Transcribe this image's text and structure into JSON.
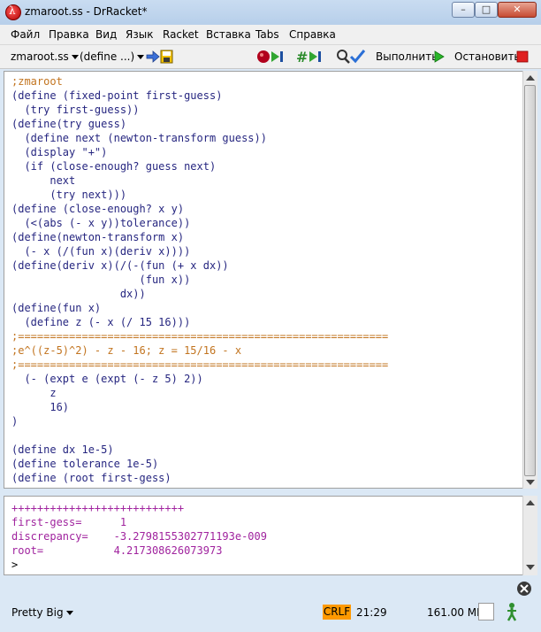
{
  "window": {
    "title": "zmaroot.ss - DrRacket*",
    "minimize": "–",
    "maximize": "□",
    "close": "✕"
  },
  "menu": [
    "Файл",
    "Правка",
    "Вид",
    "Язык",
    "Racket",
    "Вставка",
    "Tabs",
    "Справка"
  ],
  "toolbar": {
    "file_menu": "zmaroot.ss",
    "define_menu": "(define ...)",
    "run_label": "Выполнить",
    "stop_label": "Остановить"
  },
  "editor": {
    "lines": [
      ";zmaroot",
      "(define (fixed-point first-guess)",
      "  (try first-guess))",
      "(define(try guess)",
      "  (define next (newton-transform guess))",
      "  (display \"+\")",
      "  (if (close-enough? guess next)",
      "      next",
      "      (try next)))",
      "(define (close-enough? x y)",
      "  (<(abs (- x y))tolerance))",
      "(define(newton-transform x)",
      "  (- x (/(fun x)(deriv x))))",
      "(define(deriv x)(/(-(fun (+ x dx))",
      "                    (fun x))",
      "                 dx))",
      "(define(fun x)",
      "  (define z (- x (/ 15 16)))",
      ";==========================================================",
      ";e^((z-5)^2) - z - 16; z = 15/16 - x",
      ";==========================================================",
      "  (- (expt e (expt (- z 5) 2))",
      "      z",
      "      16)",
      ")",
      "",
      "(define dx 1e-5)",
      "(define tolerance 1e-5)",
      "(define (root first-gess)"
    ]
  },
  "interactions": {
    "lines": [
      "+++++++++++++++++++++++++++",
      "first-gess=      1",
      "discrepancy=    -3.2798155302771193e-009",
      "root=           4.217308626073973",
      ">"
    ]
  },
  "status": {
    "language": "Pretty Big",
    "eol": "CRLF",
    "position": "21:29",
    "memory": "161.00 MB"
  },
  "colors": {
    "comment": "#c2741f",
    "keyword": "#262680",
    "constant": "#228b22",
    "output": "#a0239e",
    "crlf_badge": "#ff9900"
  }
}
